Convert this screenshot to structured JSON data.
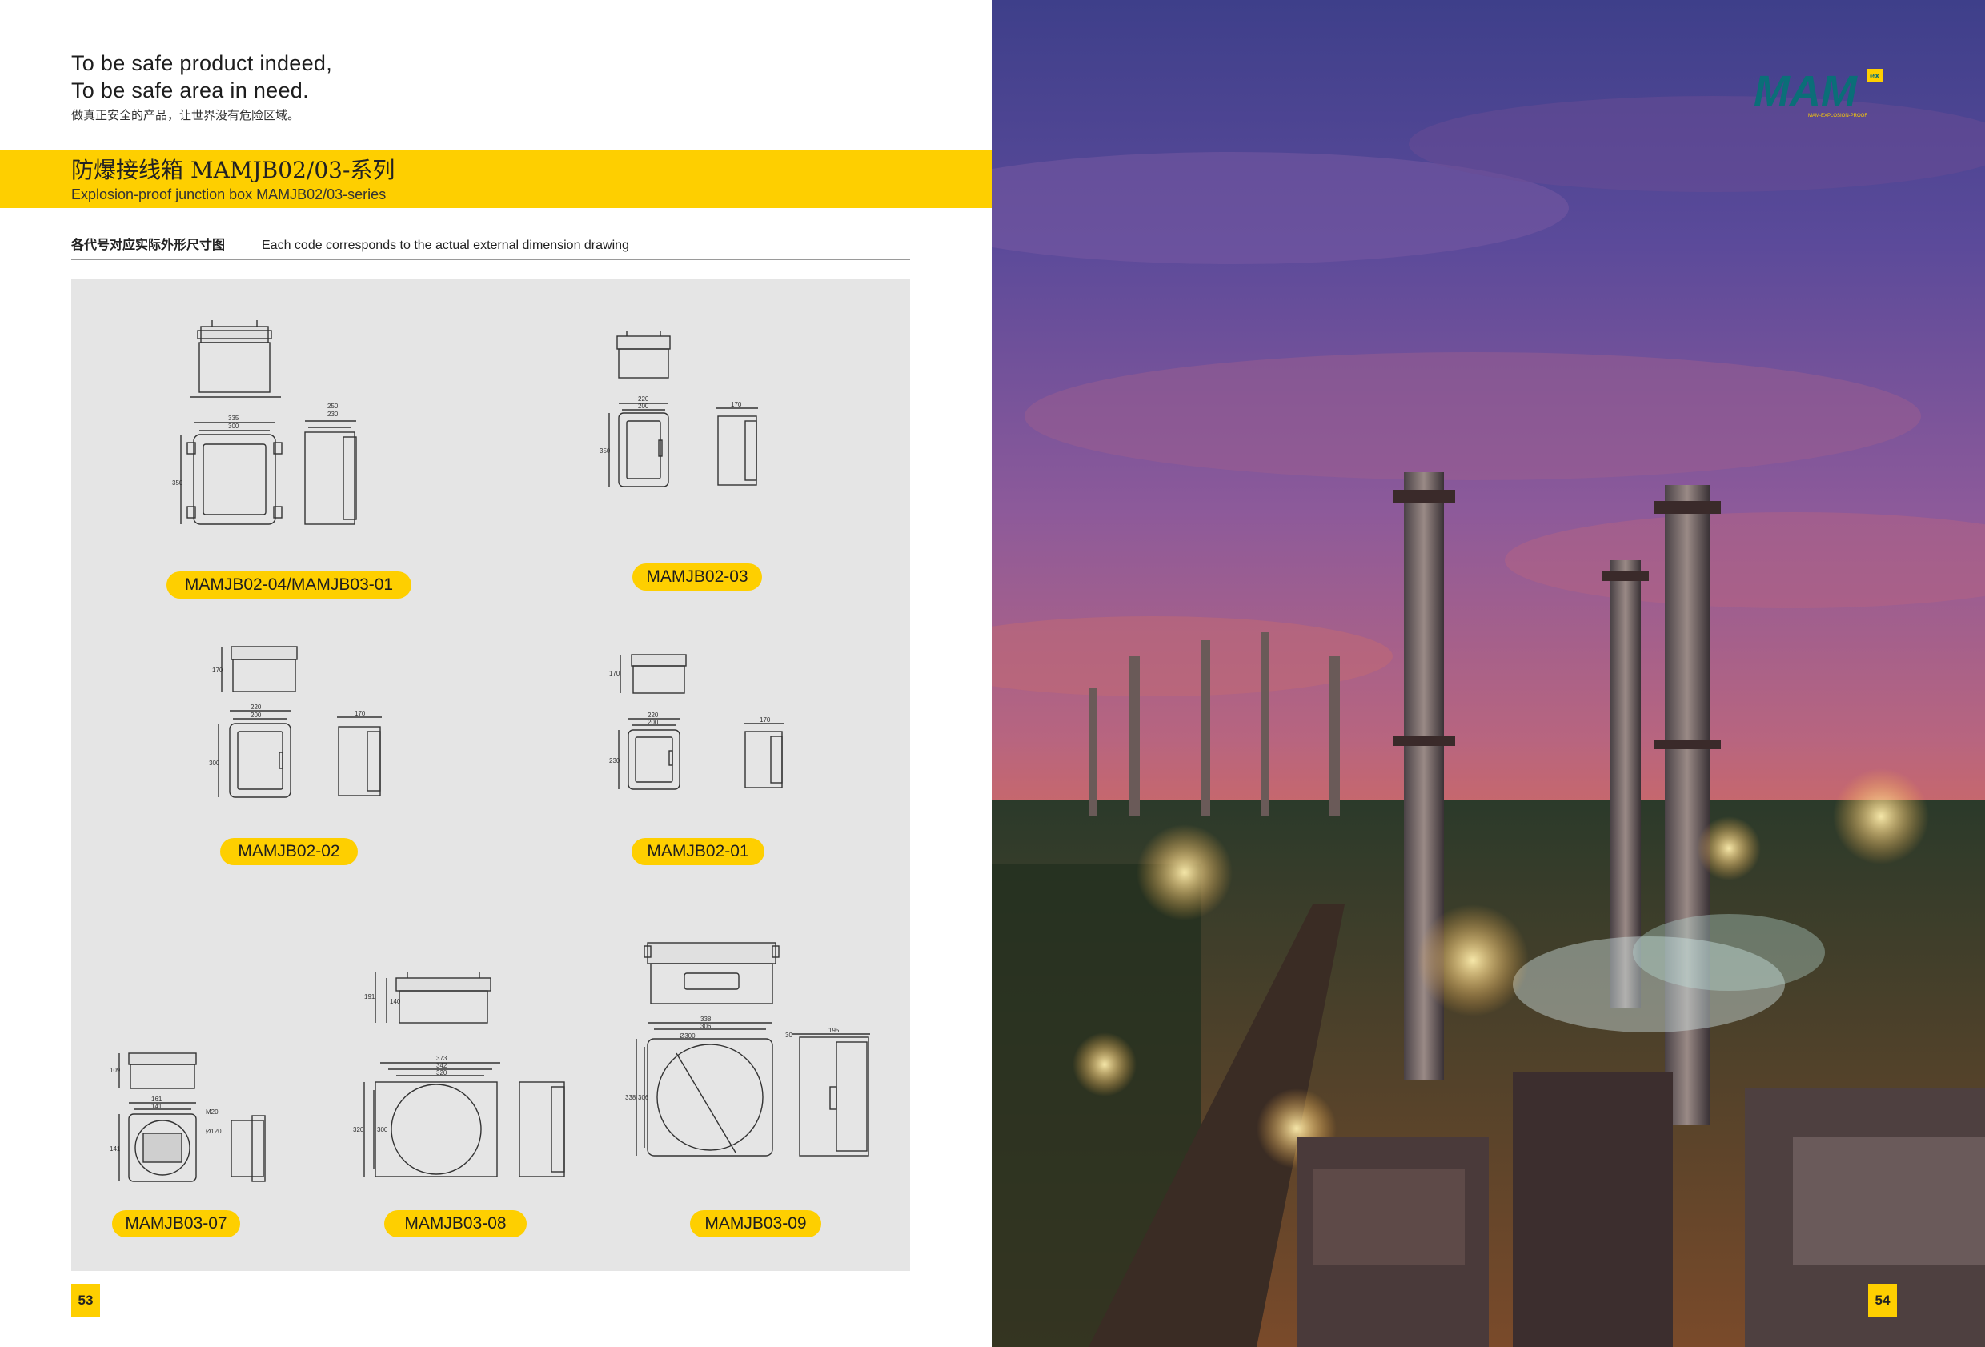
{
  "slogan": {
    "line1": "To be safe product indeed,",
    "line2": "To be safe area in need.",
    "chinese": "做真正安全的产品，让世界没有危险区域。"
  },
  "header": {
    "title_cn": "防爆接线箱 MAMJB02/03-系列",
    "title_en": "Explosion-proof junction box MAMJB02/03-series"
  },
  "subheading": {
    "cn": "各代号对应实际外形尺寸图",
    "en": "Each code corresponds to the actual external dimension drawing"
  },
  "models": [
    "MAMJB02-04/MAMJB03-01",
    "MAMJB02-03",
    "MAMJB02-02",
    "MAMJB02-01",
    "MAMJB03-07",
    "MAMJB03-08",
    "MAMJB03-09"
  ],
  "dimensions": {
    "jb0204": [
      "335",
      "300",
      "250",
      "230",
      "350"
    ],
    "jb0203": [
      "220",
      "200",
      "170",
      "350"
    ],
    "jb0202": [
      "170",
      "220",
      "200",
      "170",
      "300"
    ],
    "jb0201": [
      "170",
      "220",
      "200",
      "170",
      "230"
    ],
    "jb0307": [
      "109",
      "161",
      "141",
      "M20",
      "Ø120",
      "141"
    ],
    "jb0308": [
      "191",
      "140",
      "373",
      "342",
      "320",
      "320",
      "300"
    ],
    "jb0309": [
      "338",
      "306",
      "Ø300",
      "338",
      "306",
      "195",
      "30"
    ]
  },
  "page_numbers": {
    "left": "53",
    "right": "54"
  },
  "logo": {
    "mark": "MAM",
    "badge": "ex",
    "tagline": "MAM-EXPLOSION-PROOF"
  },
  "colors": {
    "brand_yellow": "#fecf00",
    "panel_gray": "#e5e5e5",
    "logo_teal": "#0b6e78"
  }
}
